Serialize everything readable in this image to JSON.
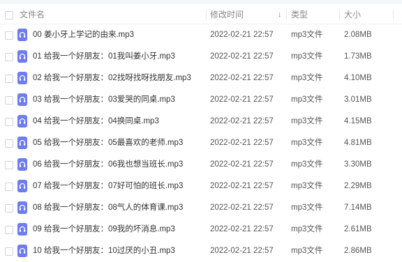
{
  "header": {
    "name": "文件名",
    "modified": "修改时间",
    "sort_icon": "arrow-down-icon",
    "type": "类型",
    "size": "大小"
  },
  "rows": [
    {
      "name": "00 姜小牙上学记的由来.mp3",
      "modified": "2022-02-21 22:57",
      "type": "mp3文件",
      "size": "2.08MB"
    },
    {
      "name": "01 给我一个好朋友：01我叫姜小牙.mp3",
      "modified": "2022-02-21 22:57",
      "type": "mp3文件",
      "size": "1.73MB"
    },
    {
      "name": "02 给我一个好朋友：02找呀找呀找朋友.mp3",
      "modified": "2022-02-21 22:57",
      "type": "mp3文件",
      "size": "4.10MB"
    },
    {
      "name": "03 给我一个好朋友：03爱哭的同桌.mp3",
      "modified": "2022-02-21 22:57",
      "type": "mp3文件",
      "size": "3.01MB"
    },
    {
      "name": "04 给我一个好朋友：04换同桌.mp3",
      "modified": "2022-02-21 22:57",
      "type": "mp3文件",
      "size": "4.15MB"
    },
    {
      "name": "05 给我一个好朋友：05最喜欢的老师.mp3",
      "modified": "2022-02-21 22:57",
      "type": "mp3文件",
      "size": "4.81MB"
    },
    {
      "name": "06 给我一个好朋友：06我也想当班长.mp3",
      "modified": "2022-02-21 22:57",
      "type": "mp3文件",
      "size": "3.30MB"
    },
    {
      "name": "07 给我一个好朋友：07好可怕的班长.mp3",
      "modified": "2022-02-21 22:57",
      "type": "mp3文件",
      "size": "2.29MB"
    },
    {
      "name": "08 给我一个好朋友：08气人的体育课.mp3",
      "modified": "2022-02-21 22:57",
      "type": "mp3文件",
      "size": "7.14MB"
    },
    {
      "name": "09 给我一个好朋友：09我的坏消息.mp3",
      "modified": "2022-02-21 22:57",
      "type": "mp3文件",
      "size": "2.61MB"
    },
    {
      "name": "10 给我一个好朋友：10过厌的小丑.mp3",
      "modified": "2022-02-21 22:57",
      "type": "mp3文件",
      "size": "2.86MB"
    }
  ],
  "colors": {
    "accent": "#3b8cf0",
    "file_icon": "#6d7cf0"
  },
  "icons": {
    "file": "headphones-icon",
    "checkbox": "checkbox-icon"
  }
}
